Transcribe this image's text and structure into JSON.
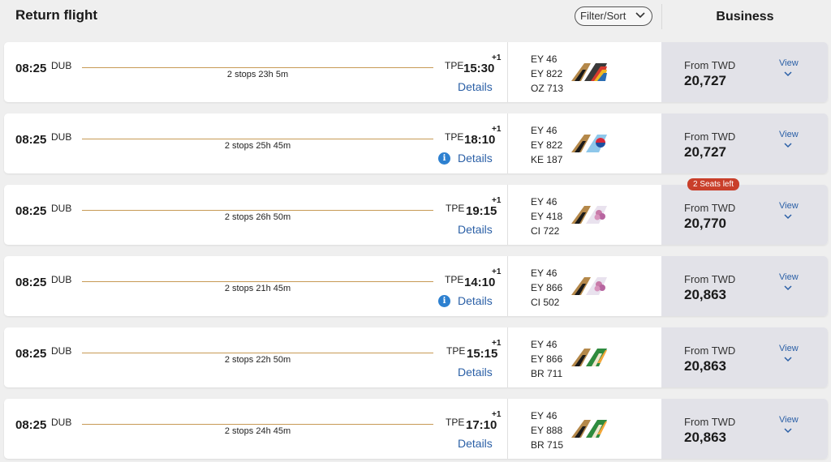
{
  "header": {
    "title": "Return flight",
    "filter_label": "Filter/Sort",
    "cabin": "Business"
  },
  "flights": [
    {
      "dep_time": "08:25",
      "dep_code": "DUB",
      "stops": "2 stops 23h 5m",
      "arr_code": "TPE",
      "arr_time": "15:30",
      "day_offset": "+1",
      "details": "Details",
      "info": false,
      "flight_numbers": [
        "EY 46",
        "EY 822",
        "OZ 713"
      ],
      "tail": "etihad-asiana",
      "from": "From TWD",
      "price": "20,727",
      "view": "View",
      "seats_left": null
    },
    {
      "dep_time": "08:25",
      "dep_code": "DUB",
      "stops": "2 stops 25h 45m",
      "arr_code": "TPE",
      "arr_time": "18:10",
      "day_offset": "+1",
      "details": "Details",
      "info": true,
      "flight_numbers": [
        "EY 46",
        "EY 822",
        "KE 187"
      ],
      "tail": "etihad-korean-air",
      "from": "From TWD",
      "price": "20,727",
      "view": "View",
      "seats_left": null
    },
    {
      "dep_time": "08:25",
      "dep_code": "DUB",
      "stops": "2 stops 26h 50m",
      "arr_code": "TPE",
      "arr_time": "19:15",
      "day_offset": "+1",
      "details": "Details",
      "info": false,
      "flight_numbers": [
        "EY 46",
        "EY 418",
        "CI 722"
      ],
      "tail": "etihad-china-airlines",
      "from": "From TWD",
      "price": "20,770",
      "view": "View",
      "seats_left": "2 Seats left"
    },
    {
      "dep_time": "08:25",
      "dep_code": "DUB",
      "stops": "2 stops 21h 45m",
      "arr_code": "TPE",
      "arr_time": "14:10",
      "day_offset": "+1",
      "details": "Details",
      "info": true,
      "flight_numbers": [
        "EY 46",
        "EY 866",
        "CI 502"
      ],
      "tail": "etihad-china-airlines",
      "from": "From TWD",
      "price": "20,863",
      "view": "View",
      "seats_left": null
    },
    {
      "dep_time": "08:25",
      "dep_code": "DUB",
      "stops": "2 stops 22h 50m",
      "arr_code": "TPE",
      "arr_time": "15:15",
      "day_offset": "+1",
      "details": "Details",
      "info": false,
      "flight_numbers": [
        "EY 46",
        "EY 866",
        "BR 711"
      ],
      "tail": "etihad-eva-air",
      "from": "From TWD",
      "price": "20,863",
      "view": "View",
      "seats_left": null
    },
    {
      "dep_time": "08:25",
      "dep_code": "DUB",
      "stops": "2 stops 24h 45m",
      "arr_code": "TPE",
      "arr_time": "17:10",
      "day_offset": "+1",
      "details": "Details",
      "info": false,
      "flight_numbers": [
        "EY 46",
        "EY 888",
        "BR 715"
      ],
      "tail": "etihad-eva-air",
      "from": "From TWD",
      "price": "20,863",
      "view": "View",
      "seats_left": null
    }
  ],
  "colors": {
    "route_line": "#c79a55",
    "link": "#2a5fa6",
    "price_panel": "#e2e2e8",
    "seats_badge": "#c93f2a",
    "info": "#2d80d0"
  }
}
